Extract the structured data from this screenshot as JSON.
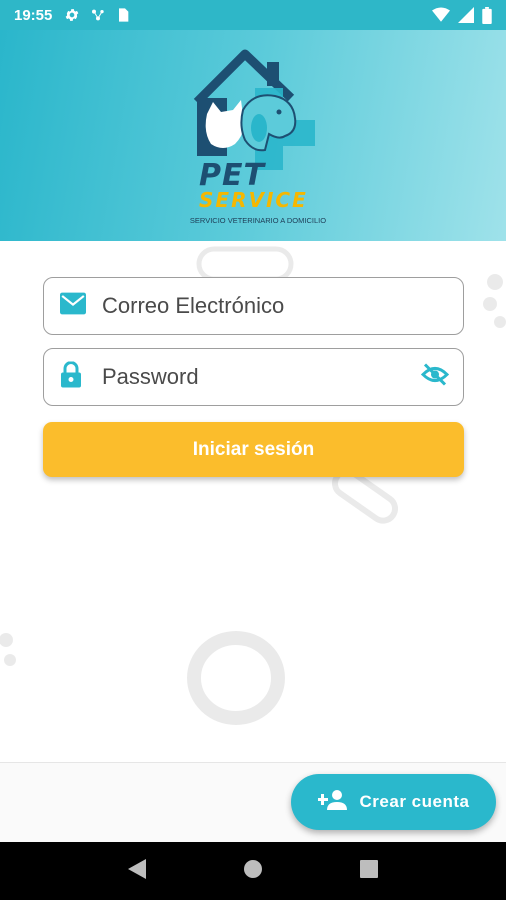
{
  "status_bar": {
    "time": "19:55",
    "left_icons": [
      "gear-icon",
      "network-icon",
      "sim-card-icon"
    ],
    "right_icons": [
      "wifi-icon",
      "signal-icon",
      "battery-icon"
    ]
  },
  "header": {
    "logo": {
      "word1": "PET",
      "word2": "SERVICE",
      "tagline": "SERVICIO VETERINARIO A DOMICILIO"
    },
    "colors": {
      "gradient_start": "#2ab6cb",
      "gradient_end": "#9fe2ea"
    }
  },
  "form": {
    "email": {
      "placeholder": "Correo Electrónico",
      "icon": "mail-icon"
    },
    "password": {
      "placeholder": "Password",
      "icon": "lock-icon",
      "toggle_icon": "visibility-off-icon"
    },
    "login_label": "Iniciar sesión"
  },
  "actions": {
    "create_account_label": "Crear cuenta",
    "create_account_icon": "person-add-icon"
  },
  "nav": {
    "icons": [
      "back-icon",
      "home-icon",
      "recents-icon"
    ]
  },
  "colors": {
    "accent": "#2ab8cc",
    "button_yellow": "#fbbd2c",
    "logo_navy": "#1d4f72",
    "logo_yellow": "#f5b700"
  }
}
